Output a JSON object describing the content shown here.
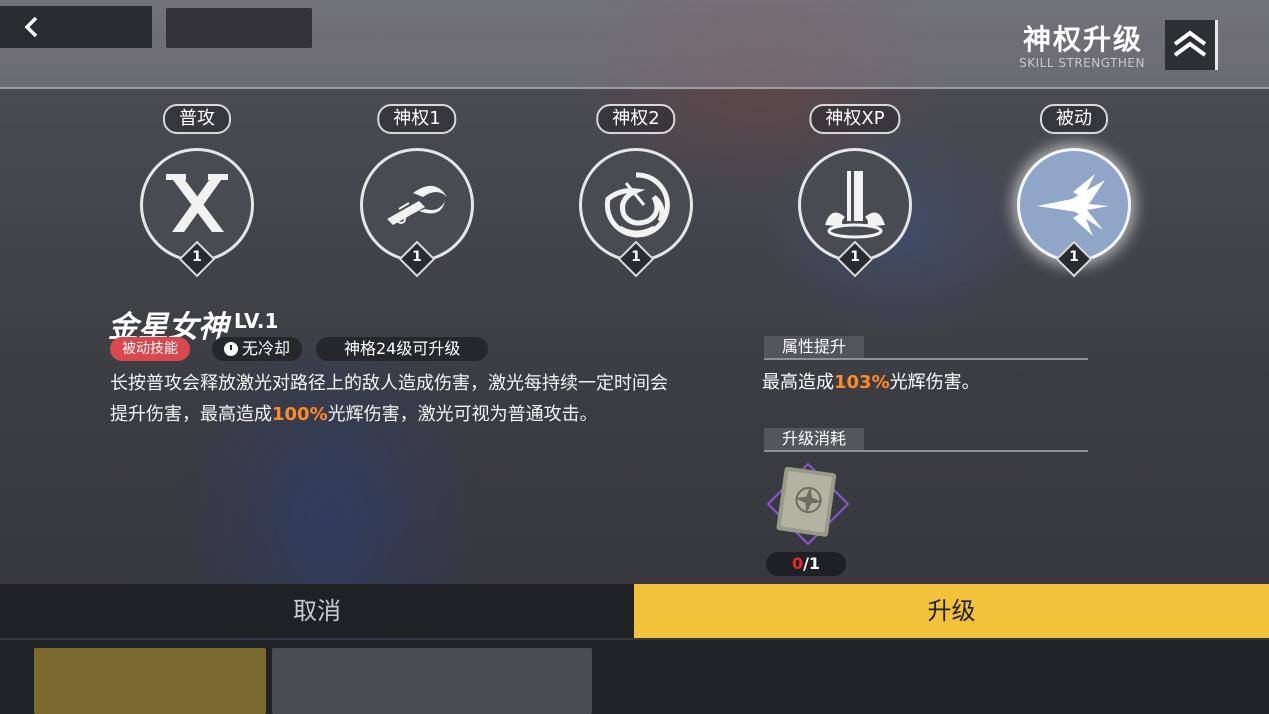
{
  "header": {
    "title": "神权升级",
    "subtitle": "SKILL STRENGTHEN"
  },
  "skills": [
    {
      "label": "普攻",
      "level": "1",
      "icon": "cross-blades-icon"
    },
    {
      "label": "神权1",
      "level": "1",
      "icon": "dash-strike-icon"
    },
    {
      "label": "神权2",
      "level": "1",
      "icon": "vortex-slash-icon"
    },
    {
      "label": "神权XP",
      "level": "1",
      "icon": "light-pillar-icon"
    },
    {
      "label": "被动",
      "level": "1",
      "icon": "laser-burst-icon"
    }
  ],
  "selected_skill_index": 4,
  "detail": {
    "name": "金星女神",
    "level": "LV.1",
    "tags": {
      "type": "被动技能",
      "cooldown": "无冷却",
      "requirement": "神格24级可升级"
    },
    "description_parts": {
      "before": "长按普攻会释放激光对路径上的敌人造成伤害，激光每持续一定时间会提升伤害，最高造成",
      "highlight": "100%",
      "after": "光辉伤害，激光可视为普通攻击。"
    }
  },
  "attribute": {
    "heading": "属性提升",
    "text_before": "最高造成",
    "highlight": "103%",
    "text_after": "光辉伤害。"
  },
  "cost": {
    "heading": "升级消耗",
    "item_icon": "skill-book-icon",
    "owned": "0",
    "required": "/1"
  },
  "actions": {
    "cancel": "取消",
    "upgrade": "升级"
  },
  "colors": {
    "accent": "#f2c23a",
    "highlight": "#ff8a28",
    "tag_red": "#d9474f",
    "shortage": "#e02a2a"
  }
}
